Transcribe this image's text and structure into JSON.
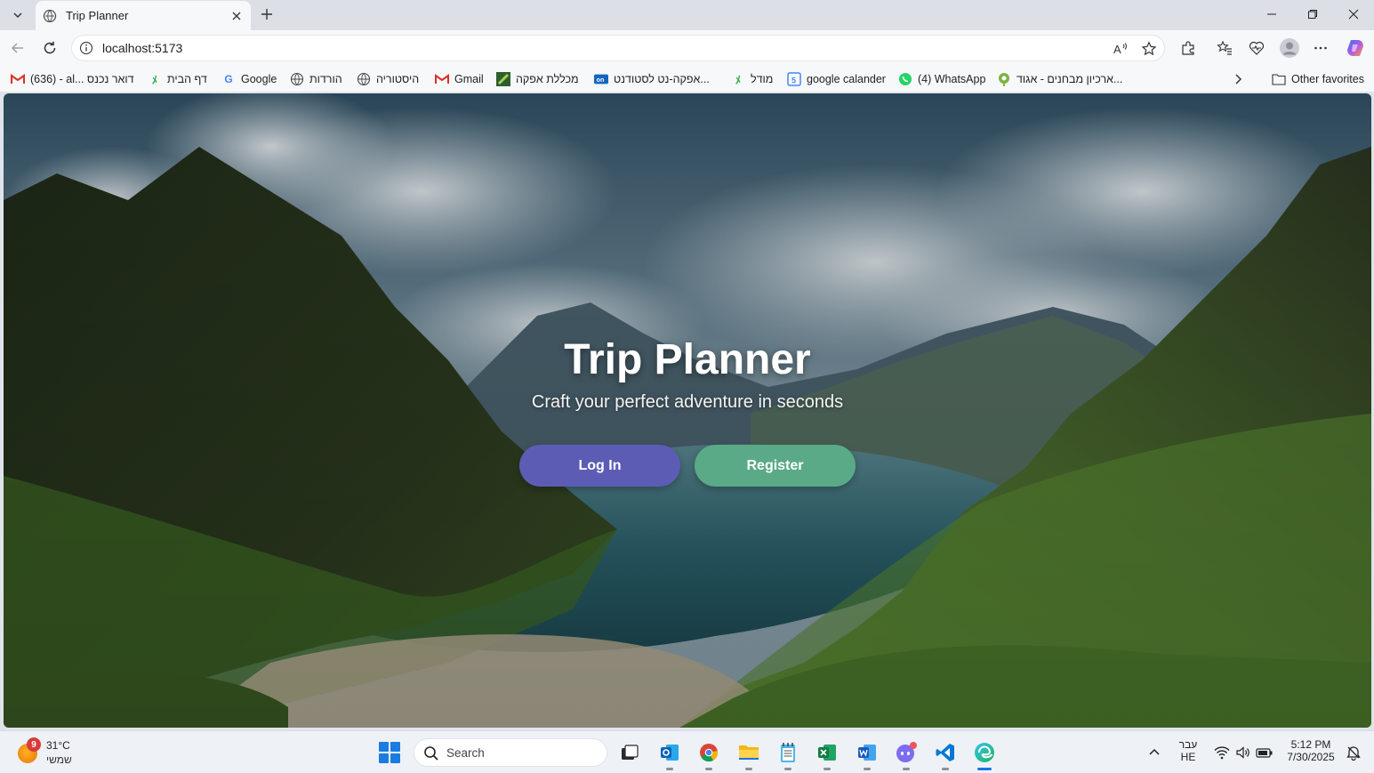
{
  "browser": {
    "tab": {
      "title": "Trip Planner"
    },
    "address": {
      "url": "localhost:5173"
    },
    "favorites": [
      {
        "label": "(636) - al... דואר נכנס",
        "icon": "gmail-icon"
      },
      {
        "label": "דף הבית",
        "icon": "moodle-icon"
      },
      {
        "label": "Google",
        "icon": "google-icon"
      },
      {
        "label": "הורדות",
        "icon": "globe-icon"
      },
      {
        "label": "היסטוריה",
        "icon": "globe-icon"
      },
      {
        "label": "Gmail",
        "icon": "gmail-icon"
      },
      {
        "label": "מכללת אפקה",
        "icon": "afeka-icon"
      },
      {
        "label": "אפקה-נט לסטודנט...",
        "icon": "afekanet-icon"
      },
      {
        "label": "מודל",
        "icon": "moodle-icon"
      },
      {
        "label": "google calander",
        "icon": "calendar-icon"
      },
      {
        "label": "(4) WhatsApp",
        "icon": "whatsapp-icon"
      },
      {
        "label": "ארכיון מבחנים - אגוד...",
        "icon": "archive-icon"
      }
    ],
    "other_favorites": "Other favorites"
  },
  "page": {
    "title": "Trip Planner",
    "subtitle": "Craft your perfect adventure in seconds",
    "login_label": "Log In",
    "register_label": "Register"
  },
  "taskbar": {
    "weather": {
      "temp": "31°C",
      "desc": "שמשי",
      "badge": "9"
    },
    "search_label": "Search",
    "lang_top": "עבר",
    "lang_bottom": "HE",
    "time": "5:12 PM",
    "date": "7/30/2025"
  },
  "colors": {
    "login_button": "#5d5cb5",
    "register_button": "#5aaa87",
    "accent": "#1a73e8"
  }
}
